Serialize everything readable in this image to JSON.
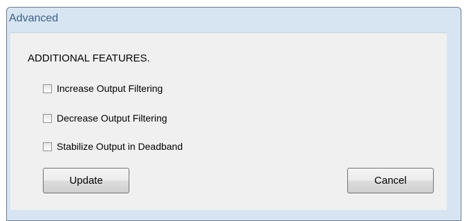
{
  "window": {
    "title": "Advanced"
  },
  "content": {
    "heading": "ADDITIONAL FEATURES.",
    "checkboxes": [
      {
        "label": "Increase Output Filtering",
        "checked": false
      },
      {
        "label": "Decrease Output Filtering",
        "checked": false
      },
      {
        "label": "Stabilize Output in Deadband",
        "checked": false
      }
    ]
  },
  "buttons": {
    "update_label": "Update",
    "cancel_label": "Cancel"
  }
}
